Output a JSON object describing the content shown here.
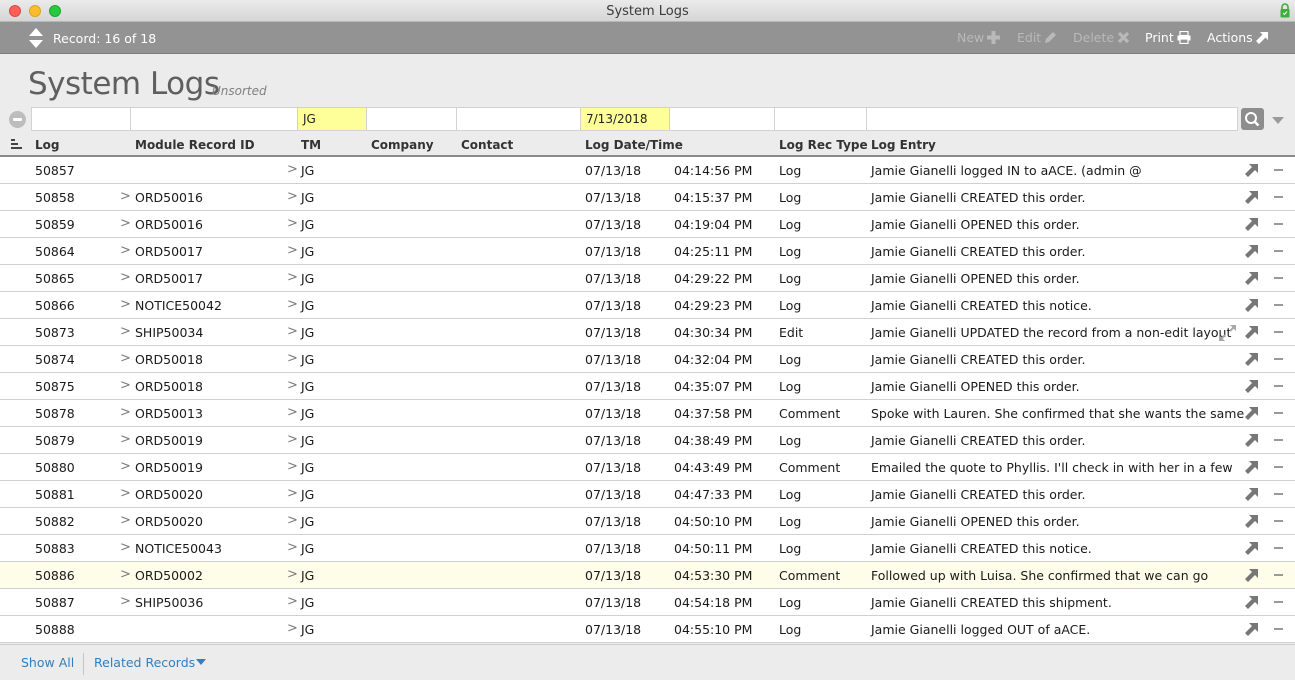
{
  "window": {
    "title": "System Logs"
  },
  "toolbar": {
    "record_label": "Record: 16 of 18",
    "buttons": [
      {
        "label": "New",
        "icon": "plus-icon",
        "enabled": false
      },
      {
        "label": "Edit",
        "icon": "pencil-icon",
        "enabled": false
      },
      {
        "label": "Delete",
        "icon": "x-icon",
        "enabled": false
      },
      {
        "label": "Print",
        "icon": "printer-icon",
        "enabled": true
      },
      {
        "label": "Actions",
        "icon": "arrow-up-right-icon",
        "enabled": true
      }
    ]
  },
  "page": {
    "title": "System Logs",
    "sort_status": "Unsorted"
  },
  "find": {
    "log": "",
    "module_record_id": "",
    "tm": "JG",
    "company": "",
    "contact": "",
    "log_date": "7/13/2018",
    "log_time": "",
    "log_rec_type": "",
    "log_entry": ""
  },
  "columns": {
    "log": "Log",
    "module_record_id": "Module Record ID",
    "tm": "TM",
    "company": "Company",
    "contact": "Contact",
    "log_datetime": "Log Date/Time",
    "log_rec_type": "Log Rec Type",
    "log_entry": "Log Entry"
  },
  "rows": [
    {
      "log": "50857",
      "module": "",
      "tm": "JG",
      "date": "07/13/18",
      "time": "04:14:56 PM",
      "type": "Log",
      "entry": "Jamie Gianelli logged IN to aACE. (admin @"
    },
    {
      "log": "50858",
      "module": "ORD50016",
      "tm": "JG",
      "date": "07/13/18",
      "time": "04:15:37 PM",
      "type": "Log",
      "entry": "Jamie Gianelli CREATED this order."
    },
    {
      "log": "50859",
      "module": "ORD50016",
      "tm": "JG",
      "date": "07/13/18",
      "time": "04:19:04 PM",
      "type": "Log",
      "entry": "Jamie Gianelli OPENED this order."
    },
    {
      "log": "50864",
      "module": "ORD50017",
      "tm": "JG",
      "date": "07/13/18",
      "time": "04:25:11 PM",
      "type": "Log",
      "entry": "Jamie Gianelli CREATED this order."
    },
    {
      "log": "50865",
      "module": "ORD50017",
      "tm": "JG",
      "date": "07/13/18",
      "time": "04:29:22 PM",
      "type": "Log",
      "entry": "Jamie Gianelli OPENED this order."
    },
    {
      "log": "50866",
      "module": "NOTICE50042",
      "tm": "JG",
      "date": "07/13/18",
      "time": "04:29:23 PM",
      "type": "Log",
      "entry": "Jamie Gianelli CREATED this notice."
    },
    {
      "log": "50873",
      "module": "SHIP50034",
      "tm": "JG",
      "date": "07/13/18",
      "time": "04:30:34 PM",
      "type": "Edit",
      "entry": "Jamie Gianelli UPDATED the record from a non-edit layout",
      "expandable": true
    },
    {
      "log": "50874",
      "module": "ORD50018",
      "tm": "JG",
      "date": "07/13/18",
      "time": "04:32:04 PM",
      "type": "Log",
      "entry": "Jamie Gianelli CREATED this order."
    },
    {
      "log": "50875",
      "module": "ORD50018",
      "tm": "JG",
      "date": "07/13/18",
      "time": "04:35:07 PM",
      "type": "Log",
      "entry": "Jamie Gianelli OPENED this order."
    },
    {
      "log": "50878",
      "module": "ORD50013",
      "tm": "JG",
      "date": "07/13/18",
      "time": "04:37:58 PM",
      "type": "Comment",
      "entry": "Spoke with Lauren. She confirmed that she wants the same"
    },
    {
      "log": "50879",
      "module": "ORD50019",
      "tm": "JG",
      "date": "07/13/18",
      "time": "04:38:49 PM",
      "type": "Log",
      "entry": "Jamie Gianelli CREATED this order."
    },
    {
      "log": "50880",
      "module": "ORD50019",
      "tm": "JG",
      "date": "07/13/18",
      "time": "04:43:49 PM",
      "type": "Comment",
      "entry": "Emailed the quote to Phyllis. I'll check in with her in a few"
    },
    {
      "log": "50881",
      "module": "ORD50020",
      "tm": "JG",
      "date": "07/13/18",
      "time": "04:47:33 PM",
      "type": "Log",
      "entry": "Jamie Gianelli CREATED this order."
    },
    {
      "log": "50882",
      "module": "ORD50020",
      "tm": "JG",
      "date": "07/13/18",
      "time": "04:50:10 PM",
      "type": "Log",
      "entry": "Jamie Gianelli OPENED this order."
    },
    {
      "log": "50883",
      "module": "NOTICE50043",
      "tm": "JG",
      "date": "07/13/18",
      "time": "04:50:11 PM",
      "type": "Log",
      "entry": "Jamie Gianelli CREATED this notice."
    },
    {
      "log": "50886",
      "module": "ORD50002",
      "tm": "JG",
      "date": "07/13/18",
      "time": "04:53:30 PM",
      "type": "Comment",
      "entry": "Followed up with Luisa. She confirmed that we can go",
      "current": true
    },
    {
      "log": "50887",
      "module": "SHIP50036",
      "tm": "JG",
      "date": "07/13/18",
      "time": "04:54:18 PM",
      "type": "Log",
      "entry": "Jamie Gianelli CREATED this shipment."
    },
    {
      "log": "50888",
      "module": "",
      "tm": "JG",
      "date": "07/13/18",
      "time": "04:55:10 PM",
      "type": "Log",
      "entry": "Jamie Gianelli logged OUT of aACE."
    }
  ],
  "footer": {
    "show_all": "Show All",
    "related_records": "Related Records"
  },
  "colors": {
    "toolbar_bg": "#939393",
    "find_active": "#ffff99",
    "current_row": "#fdfde9",
    "link": "#2f7fc1"
  }
}
